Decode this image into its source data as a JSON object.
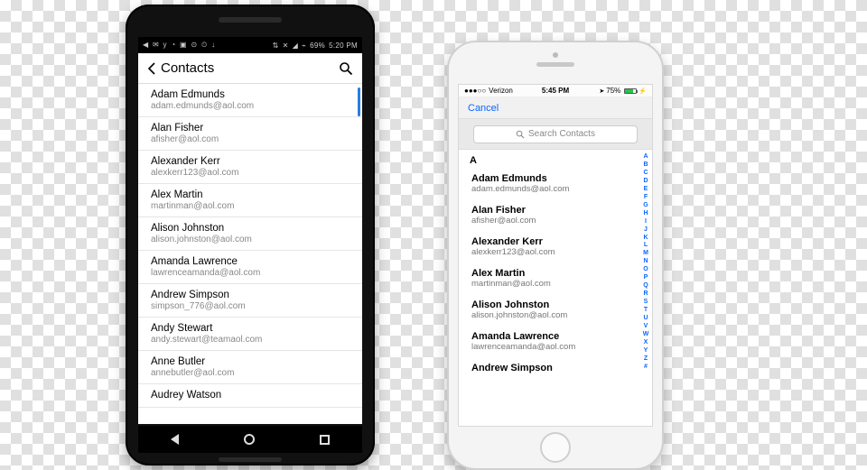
{
  "android": {
    "status": {
      "icons_left": [
        "◀",
        "✉",
        "y",
        "◔",
        "▣",
        "⊙",
        "⏲",
        "↓",
        "⇅",
        "✕",
        "◢",
        "⌁"
      ],
      "battery_text": "69%",
      "time": "5:20 PM"
    },
    "header": {
      "title": "Contacts"
    },
    "contacts": [
      {
        "name": "Adam Edmunds",
        "email": "adam.edmunds@aol.com"
      },
      {
        "name": "Alan Fisher",
        "email": "afisher@aol.com"
      },
      {
        "name": "Alexander Kerr",
        "email": "alexkerr123@aol.com"
      },
      {
        "name": "Alex Martin",
        "email": "martinman@aol.com"
      },
      {
        "name": "Alison Johnston",
        "email": "alison.johnston@aol.com"
      },
      {
        "name": "Amanda Lawrence",
        "email": "lawrenceamanda@aol.com"
      },
      {
        "name": "Andrew Simpson",
        "email": "simpson_776@aol.com"
      },
      {
        "name": "Andy Stewart",
        "email": "andy.stewart@teamaol.com"
      },
      {
        "name": "Anne Butler",
        "email": "annebutler@aol.com"
      },
      {
        "name": "Audrey Watson",
        "email": ""
      }
    ]
  },
  "ios": {
    "status": {
      "carrier": "Verizon",
      "time": "5:45 PM",
      "battery_text": "75%"
    },
    "nav": {
      "cancel": "Cancel"
    },
    "search_placeholder": "Search Contacts",
    "section": "A",
    "contacts": [
      {
        "name": "Adam Edmunds",
        "email": "adam.edmunds@aol.com"
      },
      {
        "name": "Alan Fisher",
        "email": "afisher@aol.com"
      },
      {
        "name": "Alexander Kerr",
        "email": "alexkerr123@aol.com"
      },
      {
        "name": "Alex Martin",
        "email": "martinman@aol.com"
      },
      {
        "name": "Alison Johnston",
        "email": "alison.johnston@aol.com"
      },
      {
        "name": "Amanda Lawrence",
        "email": "lawrenceamanda@aol.com"
      },
      {
        "name": "Andrew Simpson",
        "email": ""
      }
    ],
    "index": [
      "A",
      "B",
      "C",
      "D",
      "E",
      "F",
      "G",
      "H",
      "I",
      "J",
      "K",
      "L",
      "M",
      "N",
      "O",
      "P",
      "Q",
      "R",
      "S",
      "T",
      "U",
      "V",
      "W",
      "X",
      "Y",
      "Z",
      "#"
    ]
  }
}
